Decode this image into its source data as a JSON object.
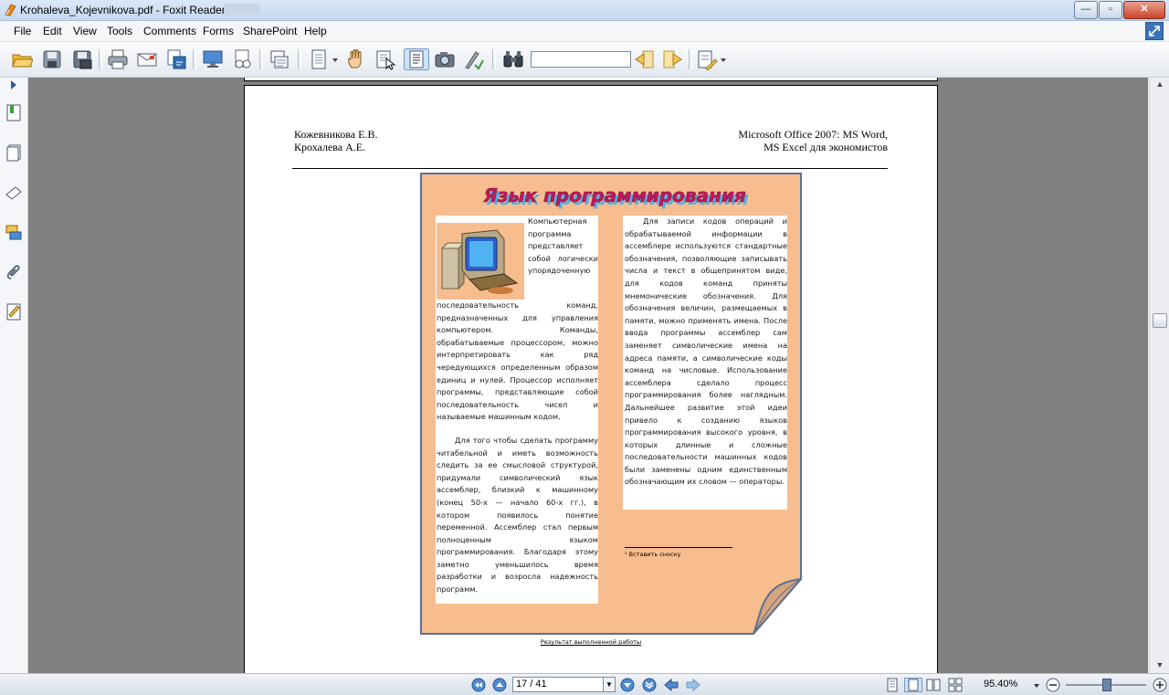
{
  "window": {
    "title": "Krohaleva_Kojevnikova.pdf - Foxit Reader",
    "buttons": {
      "minimize": "—",
      "maximize": "▫",
      "close": "✕"
    }
  },
  "menu": [
    {
      "label": "File"
    },
    {
      "label": "Edit"
    },
    {
      "label": "View"
    },
    {
      "label": "Tools"
    },
    {
      "label": "Comments"
    },
    {
      "label": "Forms"
    },
    {
      "label": "SharePoint"
    },
    {
      "label": "Help"
    }
  ],
  "toolbar": {
    "find_value": "",
    "icons": [
      "open-icon",
      "save-icon",
      "save-as-icon",
      "print-icon",
      "email-icon",
      "convert-icon",
      "present-icon",
      "document-properties-icon",
      "pages-icon",
      "view-mode-icon",
      "hand-tool-icon",
      "select-text-icon",
      "text-select-icon",
      "snapshot-icon",
      "typewriter-icon",
      "find-icon",
      "previous-match-icon",
      "next-match-icon",
      "highlight-icon"
    ]
  },
  "page": {
    "header_left": [
      "Кожевникова Е.В.",
      "Крохалева А.Е."
    ],
    "header_right": [
      "Microsoft Office 2007: MS Word,",
      "MS Excel для экономистов"
    ],
    "heading": "Язык программирования",
    "left_column": "Компьютерная программа представляет собой логически упорядоченную последовательность команд, предназначенных для управления компьютером. Команды, обрабатываемые процессором, можно интерпретировать как ряд чередующихся определенным образом единиц и нулей. Процессор исполняет программы, представляющие собой последовательность чисел и называемые машинным кодом.",
    "left_column_p2": "Для того чтобы сделать программу читабельной и иметь возможность следить за ее смысловой структурой, придумали символический язык ассемблер, близкий к машинному (конец 50-х — начало 60-х гг.), в котором появилось понятие переменной. Ассемблер стал первым полноценным языком программирования. Благодаря этому заметно уменьшилось время разработки и возросла надежность программ.",
    "right_column": "Для записи кодов операций и обрабатываемой информации в ассемблере используются стандартные обозначения, позволяющие записывать числа и текст в общепринятом виде, для кодов команд приняты мнемонические обозначения. Для обозначения величин, размещаемых в памяти, можно применять имена. После ввода программы ассемблер сам заменяет символические имена на адреса памяти, а символические коды команд на числовые. Использование ассемблера сделало процесс программирования более наглядным. Дальнейшее развитие этой идеи привело к созданию языков программирования высокого уровня, в которых длинные и сложные последовательности машинных кодов были заменены одним единственным обозначающим их словом — операторы.",
    "footnote": "¹ Вставить сноску",
    "caption": "Результат выполненной работы"
  },
  "statusbar": {
    "page_value": "17 / 41",
    "zoom": "95.40%"
  },
  "colors": {
    "scroll_fill": "#f7bd8f",
    "scroll_border": "#5a6f95",
    "heading": "#c2185b"
  }
}
